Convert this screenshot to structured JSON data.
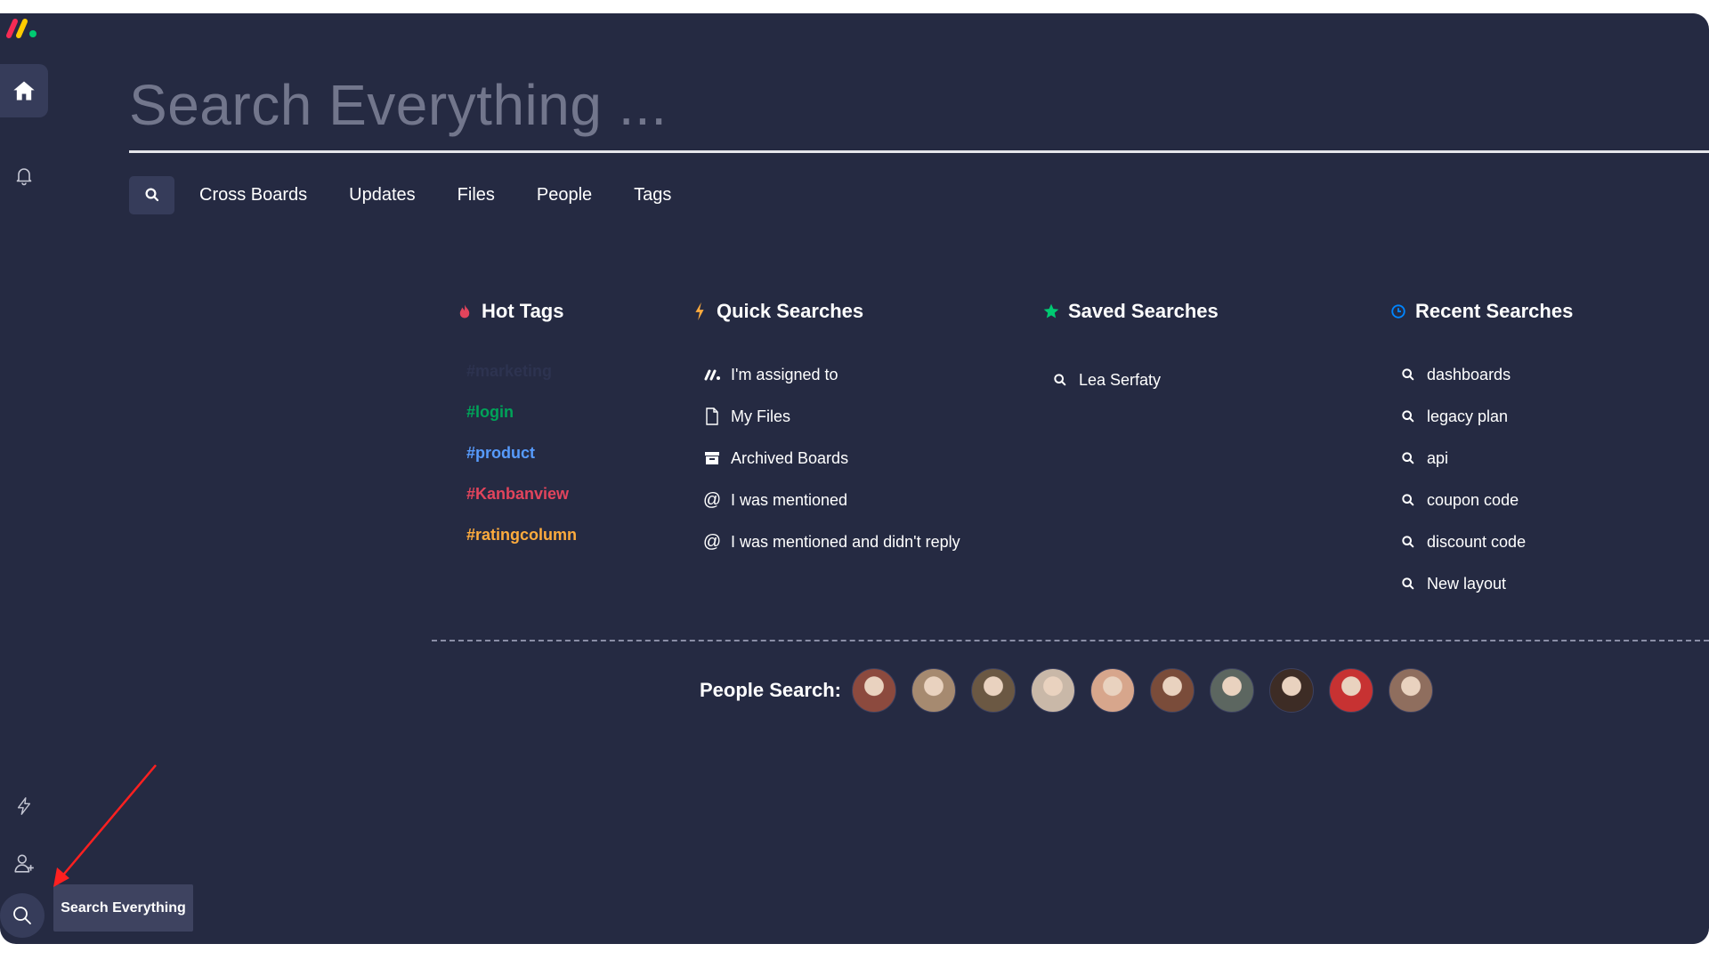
{
  "search": {
    "placeholder": "Search Everything ...",
    "filters": [
      "Cross Boards",
      "Updates",
      "Files",
      "People",
      "Tags"
    ]
  },
  "hot_tags": {
    "title": "Hot Tags",
    "tags": [
      {
        "label": "#marketing",
        "color": "#2d3350"
      },
      {
        "label": "#login",
        "color": "#00a359"
      },
      {
        "label": "#product",
        "color": "#579bfc"
      },
      {
        "label": "#Kanbanview",
        "color": "#e2445c"
      },
      {
        "label": "#ratingcolumn",
        "color": "#fdab3d"
      }
    ]
  },
  "quick_searches": {
    "title": "Quick Searches",
    "items": [
      {
        "label": "I'm assigned to",
        "icon": "monday-logo-icon"
      },
      {
        "label": "My Files",
        "icon": "file-icon"
      },
      {
        "label": "Archived Boards",
        "icon": "archive-icon"
      },
      {
        "label": "I was mentioned",
        "icon": "at-icon"
      },
      {
        "label": "I was mentioned and didn't reply",
        "icon": "at-icon"
      }
    ]
  },
  "saved_searches": {
    "title": "Saved Searches",
    "items": [
      {
        "label": "Lea Serfaty",
        "icon": "search-icon"
      }
    ]
  },
  "recent_searches": {
    "title": "Recent Searches",
    "items": [
      {
        "label": "dashboards"
      },
      {
        "label": "legacy plan"
      },
      {
        "label": "api"
      },
      {
        "label": "coupon code"
      },
      {
        "label": "discount code"
      },
      {
        "label": "New layout"
      }
    ]
  },
  "people_search": {
    "label": "People Search:",
    "avatar_colors": [
      "#8c4a3e",
      "#a68a70",
      "#6b5843",
      "#c9b8a8",
      "#d7a68c",
      "#7a4c3a",
      "#5c6660",
      "#3d2c25",
      "#c73232",
      "#8f6e5e"
    ]
  },
  "tooltip": {
    "label": "Search Everything"
  },
  "colors": {
    "background": "#252a42",
    "accent_red": "#e2445c",
    "accent_green": "#00ca72",
    "accent_blue": "#0085ff"
  }
}
